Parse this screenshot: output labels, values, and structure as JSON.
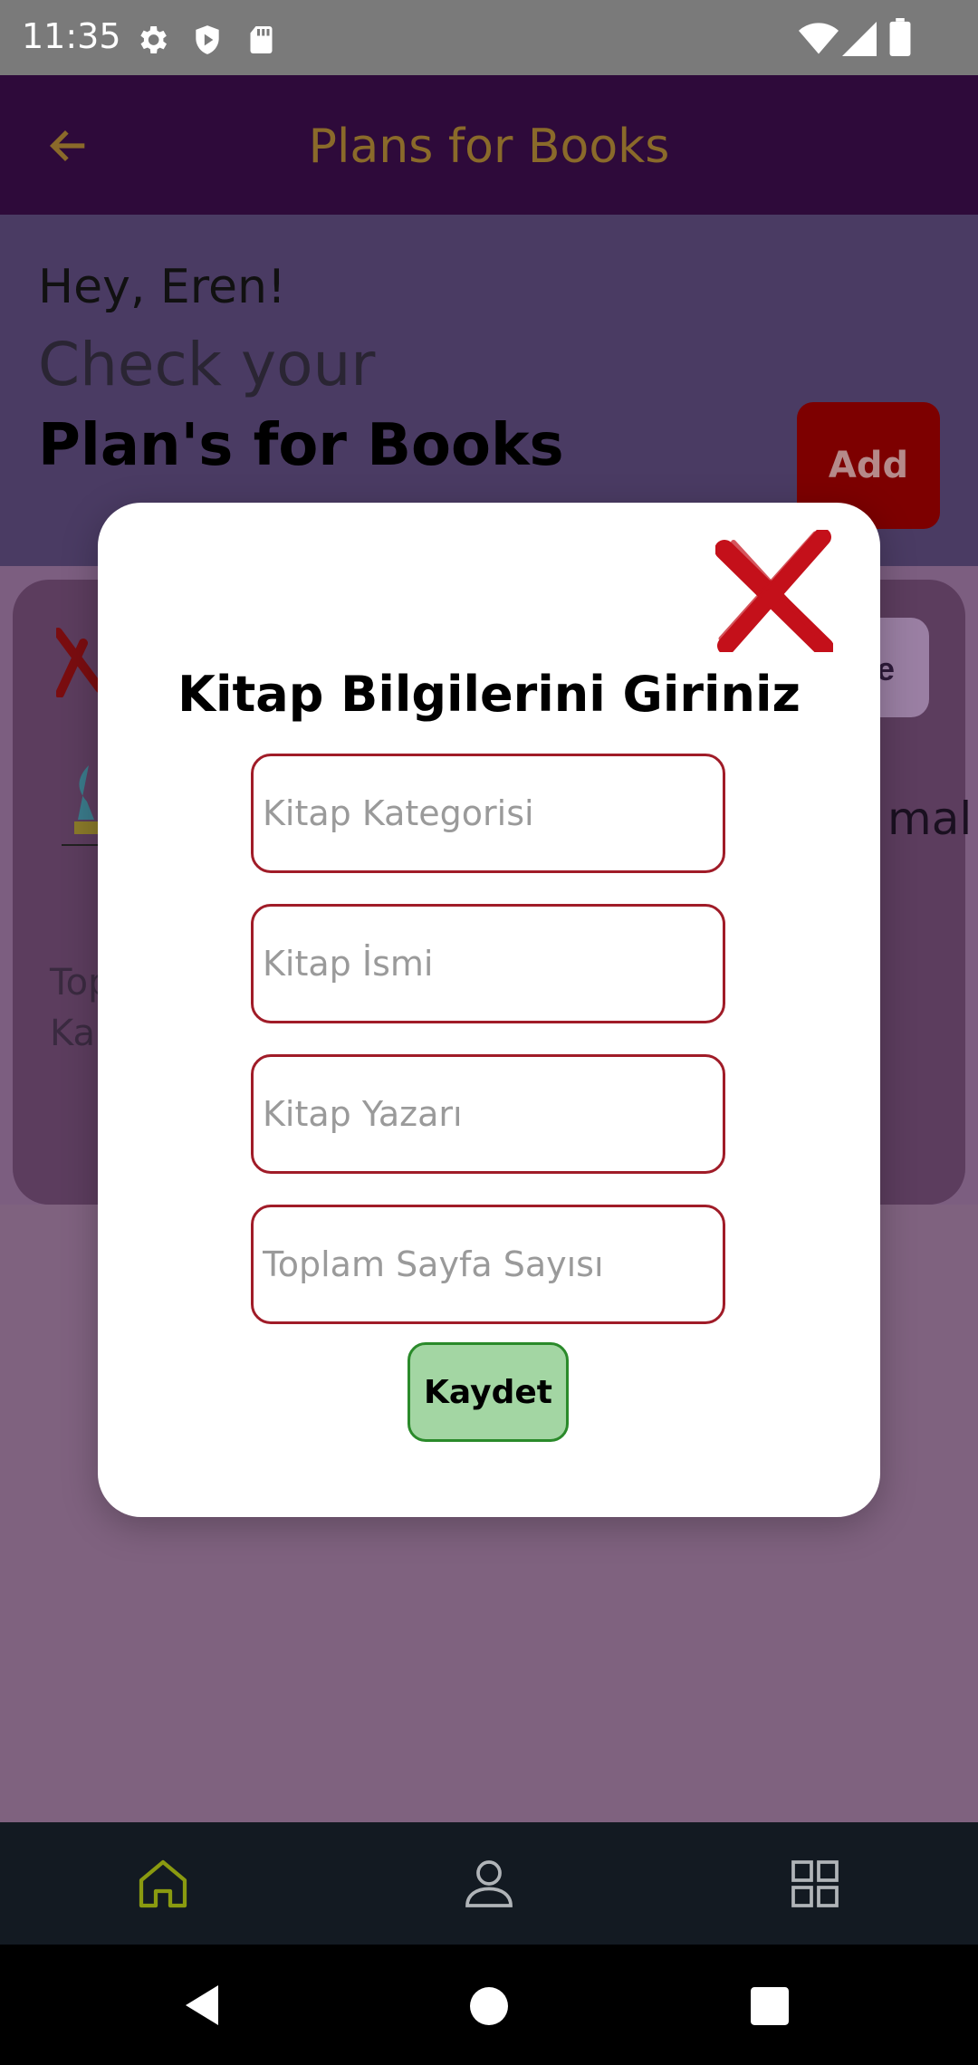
{
  "status_bar": {
    "time": "11:35",
    "icons": [
      "settings-icon",
      "shield-play-icon",
      "sd-card-icon",
      "wifi-icon",
      "signal-icon",
      "battery-icon"
    ]
  },
  "app_bar": {
    "back_icon": "arrow-left-icon",
    "title": "Plans for Books"
  },
  "header": {
    "greeting": "Hey, Eren!",
    "subtitle": "Check your",
    "heading": "Plan's for Books",
    "add_button": "Add"
  },
  "background_card": {
    "button_partial": "le",
    "partial_text_right": "mal",
    "partial_text_line1": "Top",
    "partial_text_line2": "Ka"
  },
  "dialog": {
    "title": "Kitap Bilgilerini Giriniz",
    "fields": [
      {
        "placeholder": "Kitap Kategorisi",
        "value": ""
      },
      {
        "placeholder": "Kitap İsmi",
        "value": ""
      },
      {
        "placeholder": "Kitap Yazarı",
        "value": ""
      },
      {
        "placeholder": "Toplam Sayfa Sayısı",
        "value": ""
      }
    ],
    "save_button": "Kaydet"
  },
  "bottom_nav": {
    "items": [
      {
        "icon": "home-icon",
        "active": true
      },
      {
        "icon": "person-icon",
        "active": false
      },
      {
        "icon": "grid-icon",
        "active": false
      }
    ]
  },
  "colors": {
    "app_bar": "#2e0a3a",
    "title_gold": "#8a6a2a",
    "add_button": "#7d0000",
    "field_border": "#a01c28",
    "save_button": "#a3d6a3",
    "active_nav": "#8a9a10"
  }
}
